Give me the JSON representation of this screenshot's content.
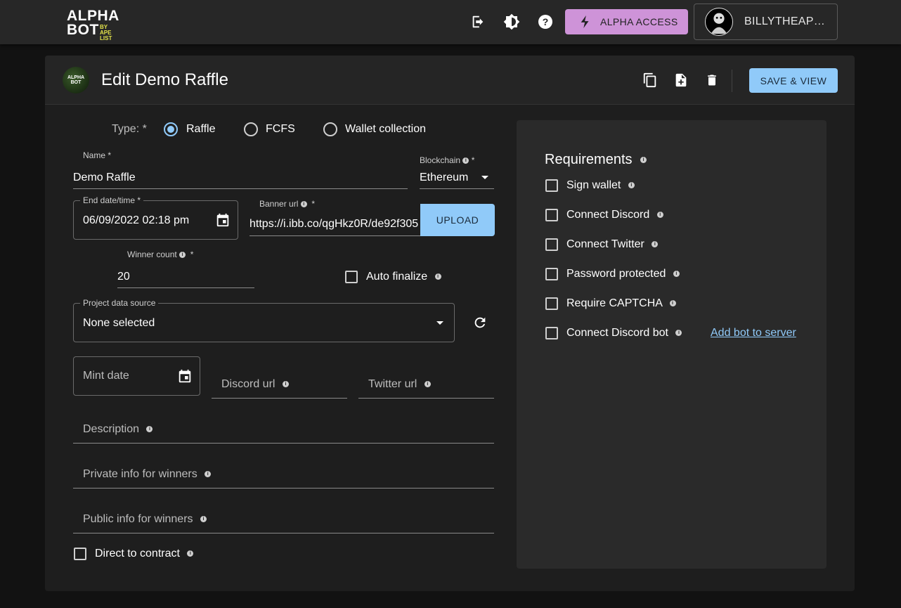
{
  "topbar": {
    "logo_line1": "ALPHA",
    "logo_line2": "BOT",
    "logo_by_line1": "BY",
    "logo_by_line2": "APE LIST",
    "alpha_access_label": "ALPHA ACCESS",
    "user_name": "BILLYTHEAP…",
    "icons": [
      "logout-icon",
      "brightness-icon",
      "help-icon",
      "lightning-icon"
    ],
    "colors": {
      "accent_purple": "#ce93d8",
      "accent_blue": "#90caf9"
    }
  },
  "header": {
    "title": "Edit Demo Raffle",
    "avatar_line1": "ALPHA",
    "avatar_line2": "BOT",
    "save_label": "SAVE & VIEW"
  },
  "form": {
    "type_label": "Type: *",
    "type_options": [
      "Raffle",
      "FCFS",
      "Wallet collection"
    ],
    "type_selected": "Raffle",
    "name_label": "Name *",
    "name_value": "Demo Raffle",
    "blockchain_label": "Blockchain",
    "blockchain_required": "*",
    "blockchain_value": "Ethereum",
    "end_date_label": "End date/time *",
    "end_date_value": "06/09/2022 02:18 pm",
    "banner_label": "Banner url",
    "banner_required": "*",
    "banner_value": "https://i.ibb.co/qgHkz0R/de92f305",
    "upload_label": "UPLOAD",
    "winner_count_label": "Winner count",
    "winner_count_required": "*",
    "winner_count_value": "20",
    "auto_finalize_label": "Auto finalize",
    "project_source_label": "Project data source",
    "project_source_value": "None selected",
    "mint_date_label": "Mint date",
    "discord_url_label": "Discord url",
    "twitter_url_label": "Twitter url",
    "description_label": "Description",
    "private_info_label": "Private info for winners",
    "public_info_label": "Public info for winners",
    "direct_contract_label": "Direct to contract"
  },
  "requirements": {
    "title": "Requirements",
    "items": [
      "Sign wallet",
      "Connect Discord",
      "Connect Twitter",
      "Password protected",
      "Require CAPTCHA",
      "Connect Discord bot"
    ],
    "add_bot_link": "Add bot to server"
  }
}
